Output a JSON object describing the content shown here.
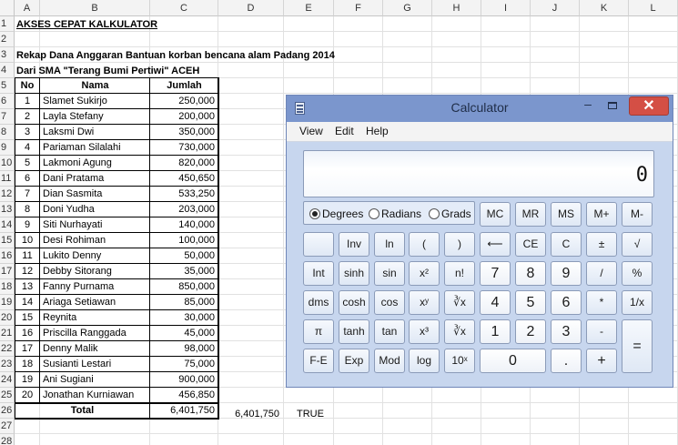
{
  "spreadsheet": {
    "columns": [
      "A",
      "B",
      "C",
      "D",
      "E",
      "F",
      "G",
      "H",
      "I",
      "J",
      "K",
      "L"
    ],
    "rows": [
      "1",
      "2",
      "3",
      "4",
      "5",
      "6",
      "7",
      "8",
      "9",
      "10",
      "11",
      "12",
      "13",
      "14",
      "15",
      "16",
      "17",
      "18",
      "19",
      "20",
      "21",
      "22",
      "23",
      "24",
      "25",
      "26",
      "27",
      "28"
    ],
    "title": "AKSES CEPAT KALKULATOR",
    "subtitle": "Rekap Dana Anggaran Bantuan korban bencana alam Padang 2014",
    "source": "Dari SMA \"Terang Bumi Pertiwi\" ACEH",
    "table": {
      "headers": [
        "No",
        "Nama",
        "Jumlah"
      ],
      "rows": [
        [
          "1",
          "Slamet Sukirjo",
          "250,000"
        ],
        [
          "2",
          "Layla Stefany",
          "200,000"
        ],
        [
          "3",
          "Laksmi Dwi",
          "350,000"
        ],
        [
          "4",
          "Pariaman Silalahi",
          "730,000"
        ],
        [
          "5",
          "Lakmoni Agung",
          "820,000"
        ],
        [
          "6",
          "Dani Pratama",
          "450,650"
        ],
        [
          "7",
          "Dian Sasmita",
          "533,250"
        ],
        [
          "8",
          "Doni Yudha",
          "203,000"
        ],
        [
          "9",
          "Siti Nurhayati",
          "140,000"
        ],
        [
          "10",
          "Desi Rohiman",
          "100,000"
        ],
        [
          "11",
          "Lukito Denny",
          "50,000"
        ],
        [
          "12",
          "Debby Sitorang",
          "35,000"
        ],
        [
          "13",
          "Fanny Purnama",
          "850,000"
        ],
        [
          "14",
          "Ariaga Setiawan",
          "85,000"
        ],
        [
          "15",
          "Reynita",
          "30,000"
        ],
        [
          "16",
          "Priscilla Ranggada",
          "45,000"
        ],
        [
          "17",
          "Denny Malik",
          "98,000"
        ],
        [
          "18",
          "Susianti Lestari",
          "75,000"
        ],
        [
          "19",
          "Ani Sugiani",
          "900,000"
        ],
        [
          "20",
          "Jonathan Kurniawan",
          "456,850"
        ]
      ],
      "total_label": "Total",
      "total_value": "6,401,750"
    },
    "d26_value": "6,401,750",
    "e26_value": "TRUE"
  },
  "calculator": {
    "title": "Calculator",
    "minimize": "–",
    "close": "✕",
    "menu": [
      "View",
      "Edit",
      "Help"
    ],
    "display": "0",
    "angle_modes": [
      "Degrees",
      "Radians",
      "Grads"
    ],
    "selected_angle": "Degrees",
    "memory_keys": [
      "MC",
      "MR",
      "MS",
      "M+",
      "M-"
    ],
    "row2": [
      "",
      "Inv",
      "ln",
      "(",
      ")",
      "⟵",
      "CE",
      "C",
      "±",
      "√"
    ],
    "row3": [
      "Int",
      "sinh",
      "sin",
      "x²",
      "n!",
      "7",
      "8",
      "9",
      "/",
      "%"
    ],
    "row4": [
      "dms",
      "cosh",
      "cos",
      "xʸ",
      "∛x",
      "4",
      "5",
      "6",
      "*",
      "1/x"
    ],
    "row5": [
      "π",
      "tanh",
      "tan",
      "x³",
      "∛x",
      "1",
      "2",
      "3",
      "-"
    ],
    "row6": [
      "F-E",
      "Exp",
      "Mod",
      "log",
      "10ˣ",
      "0",
      ".",
      "+"
    ],
    "equals": "="
  },
  "icons": {
    "app": "calculator-icon",
    "maximize": "maximize-icon",
    "radio_on": "radio-selected-icon",
    "radio_off": "radio-unselected-icon"
  }
}
